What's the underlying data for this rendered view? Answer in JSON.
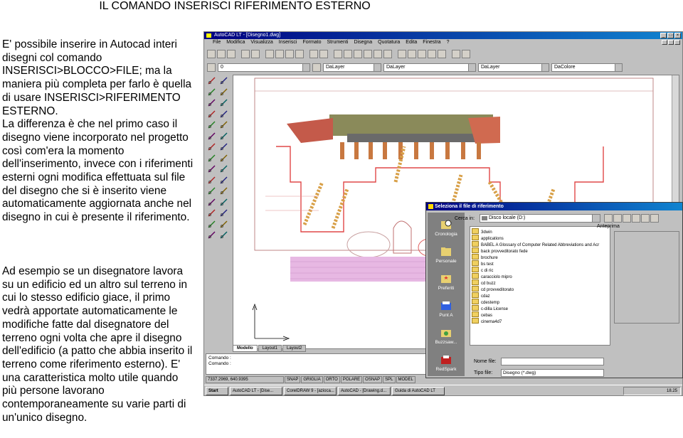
{
  "heading": "IL COMANDO INSERISCI RIFERIMENTO ESTERNO",
  "paragraphs": [
    "E' possibile inserire in Autocad interi disegni col comando INSERISCI>BLOCCO>FILE; ma la maniera più completa per farlo è quella di usare INSERISCI>RIFERIMENTO ESTERNO.",
    "La differenza è che nel primo caso il disegno viene incorporato nel progetto così com'era la momento dell'inserimento, invece con i riferimenti esterni ogni modifica effettuata sul file del disegno che si è inserito viene automaticamente aggiornata anche nel disegno in cui è presente il riferimento.",
    "Ad esempio se un disegnatore lavora su un edificio ed un altro sul terreno in cui lo stesso edificio giace, il primo vedrà apportate automaticamente le modifiche fatte dal disegnatore del terreno ogni volta che apre il disegno dell'edificio (a patto che abbia inserito il terreno come riferimento esterno). E' una caratteristica molto utile quando più persone lavorano contemporaneamente su varie parti di un'unico disegno."
  ],
  "screenshot": {
    "window_title": "AutoCAD LT - [Disegno1.dwg]",
    "menu": [
      "File",
      "Modifica",
      "Visualizza",
      "Inserisci",
      "Formato",
      "Strumenti",
      "Disegna",
      "Quotatura",
      "Edita",
      "Finestra",
      "?"
    ],
    "layer_value": "0",
    "bylayer_1": "DaLayer",
    "bylayer_2": "DaLayer",
    "bylayer_3": "DaLayer",
    "color_value": "DaColore",
    "layout_tabs": [
      "Modello",
      "Layout1",
      "Layout2"
    ],
    "command_lines": [
      "Comando :",
      "Comando :"
    ],
    "coordinates": "7337.2969, 640.9395",
    "status_buttons": [
      "SNAP",
      "GRIGLIA",
      "ORTO",
      "POLARE",
      "OSNAP",
      "SPL",
      "MODEL"
    ],
    "taskbar": {
      "start": "Start",
      "tasks": [
        "AutoCAD LT - [Dise...",
        "CorelDRAW 9 - [azioca...",
        "AutoCAD - [Drawing.d...",
        "Guida di AutoCAD LT"
      ],
      "clock": "18.25"
    },
    "dialog": {
      "title": "Seleziona il file di riferimento",
      "look_in_label": "Cerca in:",
      "look_in_value": "Disco locale (D:)",
      "preview_label": "Anteprima",
      "places": [
        "Cronologia",
        "Personale",
        "Preferiti",
        "Punt A",
        "Buzzsaw...",
        "RedSpark"
      ],
      "files": [
        "3dwin",
        "applications",
        "BABEL A Glossary of Computer Related Abbreviations and Acr",
        "back provveditorato fede",
        "brochure",
        "bs test",
        "c di ric",
        "caracciolo mipro",
        "cd buzz",
        "cd provveditorato",
        "cdaz",
        "cdestemp",
        "c-dilla License",
        "cebas",
        "cinema4d7"
      ],
      "name_label": "Nome file:",
      "type_label": "Tipo file:",
      "type_value": "Disegno (*.dwg)"
    }
  }
}
